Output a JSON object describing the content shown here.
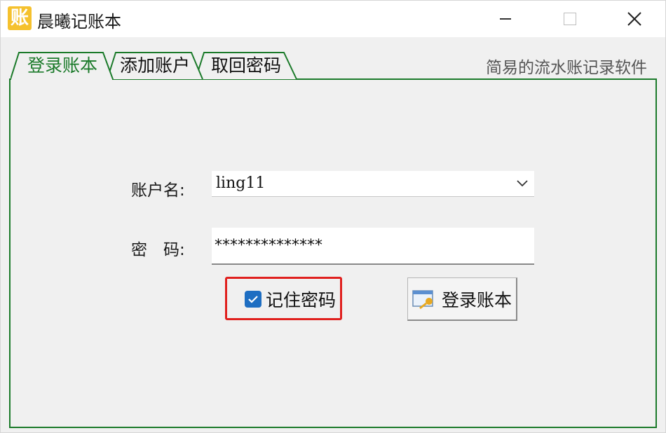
{
  "window": {
    "title": "晨曦记账本",
    "app_icon_glyph": "账",
    "app_icon_color": "#f5c12e"
  },
  "tabs": [
    {
      "label": "登录账本",
      "active": true
    },
    {
      "label": "添加账户",
      "active": false
    },
    {
      "label": "取回密码",
      "active": false
    }
  ],
  "slogan": "简易的流水账记录软件",
  "form": {
    "username_label": "账户名:",
    "username_value": "ling11",
    "password_label": "密　码:",
    "password_value": "**************",
    "remember_label": "记住密码",
    "remember_checked": true,
    "login_button": "登录账本"
  },
  "colors": {
    "tab_border": "#1b7a2a",
    "highlight": "#e0201e",
    "checkbox": "#1e6ec2"
  }
}
